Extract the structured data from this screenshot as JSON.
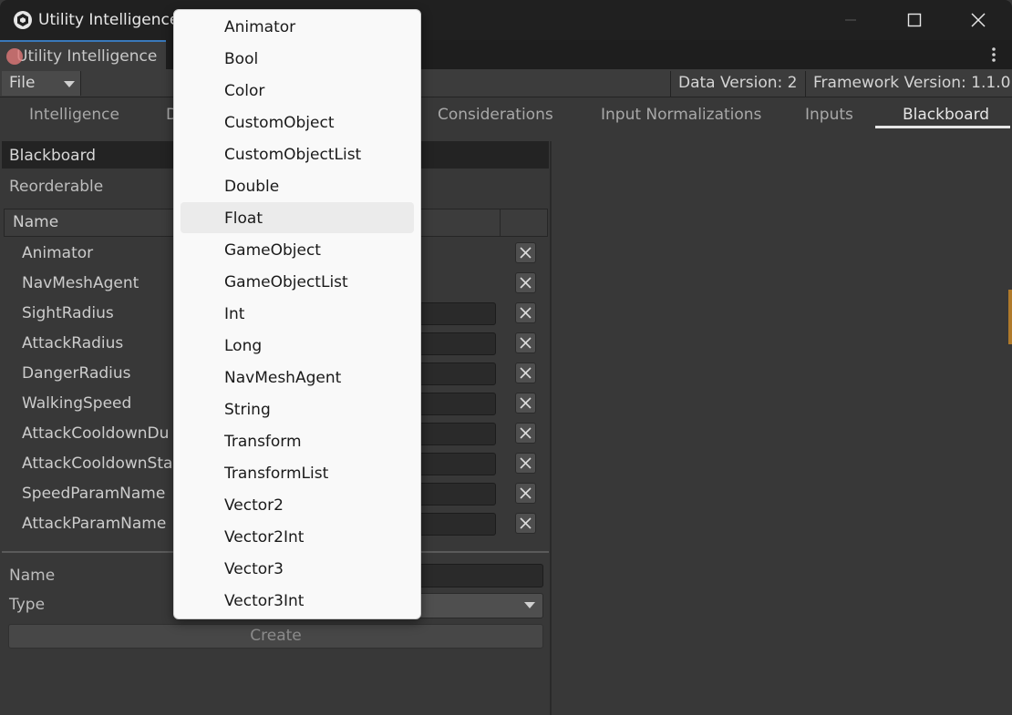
{
  "window": {
    "title": "Utility Intelligence"
  },
  "editor_tab": {
    "label": "Utility Intelligence"
  },
  "toolbar": {
    "file_menu": "File",
    "data_version": "Data Version: 2",
    "framework_version": "Framework Version: 1.1.0"
  },
  "tabs": [
    {
      "label": "Intelligence"
    },
    {
      "label": "D"
    },
    {
      "label": "Considerations"
    },
    {
      "label": "Input Normalizations"
    },
    {
      "label": "Inputs"
    },
    {
      "label": "Blackboard",
      "active": true
    }
  ],
  "blackboard": {
    "header": "Blackboard",
    "reorderable": "Reorderable",
    "column_name": "Name",
    "rows": [
      {
        "name": "Animator",
        "has_field": false
      },
      {
        "name": "NavMeshAgent",
        "has_field": false
      },
      {
        "name": "SightRadius",
        "has_field": true
      },
      {
        "name": "AttackRadius",
        "has_field": true
      },
      {
        "name": "DangerRadius",
        "has_field": true
      },
      {
        "name": "WalkingSpeed",
        "has_field": true
      },
      {
        "name": "AttackCooldownDu",
        "has_field": true
      },
      {
        "name": "AttackCooldownSta",
        "has_field": true
      },
      {
        "name": "SpeedParamName",
        "has_field": true
      },
      {
        "name": "AttackParamName",
        "has_field": true
      }
    ],
    "form": {
      "name_label": "Name",
      "type_label": "Type",
      "create_label": "Create"
    }
  },
  "dropdown": {
    "items": [
      "Animator",
      "Bool",
      "Color",
      "CustomObject",
      "CustomObjectList",
      "Double",
      "Float",
      "GameObject",
      "GameObjectList",
      "Int",
      "Long",
      "NavMeshAgent",
      "String",
      "Transform",
      "TransformList",
      "Vector2",
      "Vector2Int",
      "Vector3",
      "Vector3Int"
    ],
    "highlighted": "Float"
  }
}
